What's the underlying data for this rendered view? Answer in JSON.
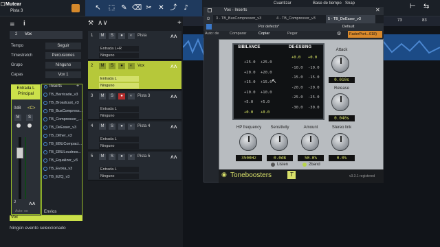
{
  "topbar": {
    "mute_label": "Mutear",
    "track_label": "Pista 3",
    "cuantizar": "Cuantizar",
    "base_tiempo": "Base de tiempo",
    "snap": "Snap"
  },
  "inspector": {
    "track_num": "2",
    "track_name": "Vox",
    "rows": [
      {
        "label": "Tempo",
        "value": "Seguir"
      },
      {
        "label": "Timestretch",
        "value": "Percusiones"
      },
      {
        "label": "Grupo",
        "value": "Ninguno"
      },
      {
        "label": "Capas",
        "value": "Vox 1"
      }
    ],
    "channel_head": "Entrada L Principal",
    "channel_level": "0dB",
    "channel_pan": "<C>",
    "channel_num": "2",
    "channel_footer": "Vox",
    "auto_label": "Auto: oo",
    "inserts_label": "Inserts",
    "sends_label": "Envíos",
    "inserts": [
      "TB_Barricade_v3",
      "TB_Broadcast_v3",
      "TB_BusCompress...",
      "TB_Compressor_...",
      "TB_DeEsser_v3",
      "TB_Dither_v3",
      "TB_EBUCompact...",
      "TB_EBULoudnes...",
      "TB_Equalizer_v3",
      "TB_Evoka_v3",
      "TB_EZQ_v3"
    ],
    "status": "Ningún evento seleccionado"
  },
  "tracks": [
    {
      "num": "1",
      "name": "Pista",
      "input": "Entrada L+R",
      "output": "Ninguno",
      "selected": false,
      "rec": false
    },
    {
      "num": "2",
      "name": "Vox",
      "input": "Entrada L",
      "output": "Ninguno",
      "selected": true,
      "rec": false
    },
    {
      "num": "3",
      "name": "Pista 3",
      "input": "Entrada L",
      "output": "Ninguno",
      "selected": false,
      "rec": true
    },
    {
      "num": "4",
      "name": "Pista 4",
      "input": "Entrada L",
      "output": "Ninguno",
      "selected": false,
      "rec": false
    },
    {
      "num": "5",
      "name": "Pista 5",
      "input": "Entrada L",
      "output": "Ninguno",
      "selected": false,
      "rec": false
    }
  ],
  "ruler": [
    "73",
    "83"
  ],
  "plugin": {
    "window_title": "Vox - Inserts",
    "tabs": [
      "3 - TB_BusCompressor_v3",
      "4 - TB_Compressor_v3",
      "5 - TB_DeEsser_v3"
    ],
    "preset": "Por defecto*",
    "preset_right": "Default",
    "auto_label": "Auto: de",
    "compare": "Comparar",
    "copy": "Copiar",
    "paste": "Pegar",
    "fader_port": "FaderPort...018)",
    "sibilance_label": "SIBILANCE",
    "deessing_label": "DE-ESSING",
    "sib_col1": [
      "+25.0",
      "+20.0",
      "+15.0",
      "+10.0",
      "+5.0",
      "+0.0"
    ],
    "sib_col2": [
      "+25.0",
      "+20.0",
      "+15.0",
      "+10.0",
      "+5.0",
      "+0.0"
    ],
    "de_col1": [
      "+0.0",
      "-10.0",
      "-15.0",
      "-20.0",
      "-25.0",
      "-30.0"
    ],
    "de_col2": [
      "+0.0",
      "-10.0",
      "-15.0",
      "-20.0",
      "-25.0",
      "-30.0"
    ],
    "attack_label": "Attack",
    "attack_value": "0.010s",
    "release_label": "Release",
    "release_value": "0.040s",
    "hp_label": "HP frequency",
    "hp_value": "3500Hz",
    "sens_label": "Sensitivity",
    "sens_value": "0.0dB",
    "amount_label": "Amount",
    "amount_value": "50.0%",
    "stereo_label": "Stereo link",
    "stereo_value": "0.0%",
    "listen_label": "Listen",
    "band_label": "2band",
    "brand": "Toneboosters",
    "version": "v3.3.1 registered"
  }
}
